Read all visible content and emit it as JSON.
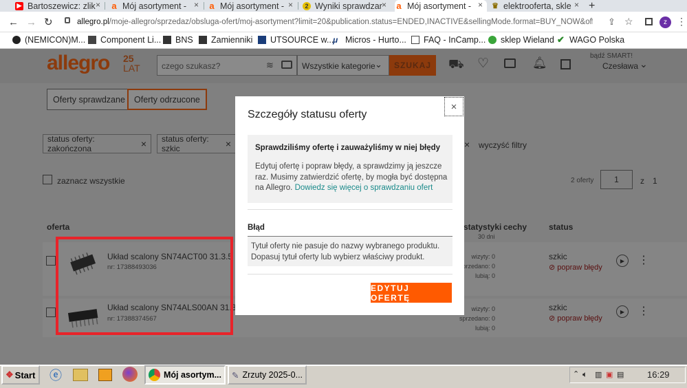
{
  "tabs": [
    {
      "label": "Bartoszewicz: zlik",
      "icon_color": "#ff0000",
      "icon": "youtube-icon"
    },
    {
      "label": "Mój asortyment -",
      "icon_color": "#ff5a00",
      "icon": "allegro-icon"
    },
    {
      "label": "Mój asortyment -",
      "icon_color": "#ff5a00",
      "icon": "allegro-icon"
    },
    {
      "label": "Wyniki sprawdzar",
      "icon_color": "#d9b500",
      "icon": "badge-icon",
      "badge": "2"
    },
    {
      "label": "Mój asortyment -",
      "icon_color": "#ff5a00",
      "icon": "allegro-icon"
    },
    {
      "label": "elektrooferta, skle",
      "icon_color": "#8a6d00",
      "icon": "crown-icon"
    }
  ],
  "new_tab": "+",
  "url": {
    "domain": "allegro.pl",
    "path": "/moje-allegro/sprzedaz/obsluga-ofert/moj-asortyment?limit=20&publication.status=ENDED,INACTIVE&sellingMode.format=BUY_NOW&offerLobby.publicatio..."
  },
  "profile_initial": "z",
  "bookmarks": [
    "(NEMICON)M...",
    "Component Li...",
    "BNS",
    "Zamienniki",
    "UTSOURCE w...",
    "Micros - Hurto...",
    "FAQ - InCamp...",
    "sklep Wieland",
    "WAGO Polska"
  ],
  "header": {
    "logo": "allegro",
    "logo_anniv": "25",
    "logo_sub": "LAT",
    "search_placeholder": "czego szukasz?",
    "category": "Wszystkie kategorie",
    "search_button": "SZUKAJ",
    "smart_label": "bądź SMART!",
    "user": "Czesława"
  },
  "filters": {
    "tab1": "Oferty sprawdzane",
    "tab2": "Oferty odrzucone",
    "chip1": "status oferty: zakończona",
    "chip2": "status oferty: szkic",
    "clear": "wyczyść filtry",
    "select_all": "zaznacz wszystkie",
    "count": "2 oferty",
    "page": "1",
    "page_of": "z",
    "page_total": "1"
  },
  "columns": {
    "offer": "oferta",
    "stats": "statystyki",
    "stats_sub": "30 dni",
    "features": "cechy",
    "status": "status"
  },
  "offers": [
    {
      "title": "Układ scalony SN74ACT00 31.3.5",
      "nr": "nr: 17388493036",
      "views": "wizyty: 0",
      "sold": "sprzedano: 0",
      "likes": "lubią: 0",
      "status": "szkic",
      "fix": "popraw błędy"
    },
    {
      "title": "Układ scalony SN74ALS00AN 31.3.5",
      "nr": "nr: 17388374567",
      "views": "wizyty: 0",
      "sold": "sprzedano: 0",
      "likes": "lubią: 0",
      "status": "szkic",
      "fix": "popraw błędy"
    }
  ],
  "modal": {
    "title": "Szczegóły statusu oferty",
    "info_title": "Sprawdziliśmy ofertę i zauważyliśmy w niej błędy",
    "info_text": "Edytuj ofertę i popraw błędy, a sprawdzimy ją jeszcze raz. Musimy zatwierdzić ofertę, by mogła być dostępna na Allegro.",
    "info_link": "Dowiedz się więcej o sprawdzaniu ofert",
    "error_heading": "Błąd",
    "error_text": "Tytuł oferty nie pasuje do nazwy wybranego produktu. Dopasuj tytuł oferty lub wybierz właściwy produkt.",
    "edit_button": "EDYTUJ OFERTĘ",
    "close": "×"
  },
  "taskbar": {
    "start": "Start",
    "item1": "Mój asortym...",
    "item2": "Zrzuty 2025-0...",
    "clock": "16:29"
  },
  "colors": {
    "accent": "#ff5a00",
    "highlight": "#e8232a",
    "link": "#1a8a8a"
  }
}
